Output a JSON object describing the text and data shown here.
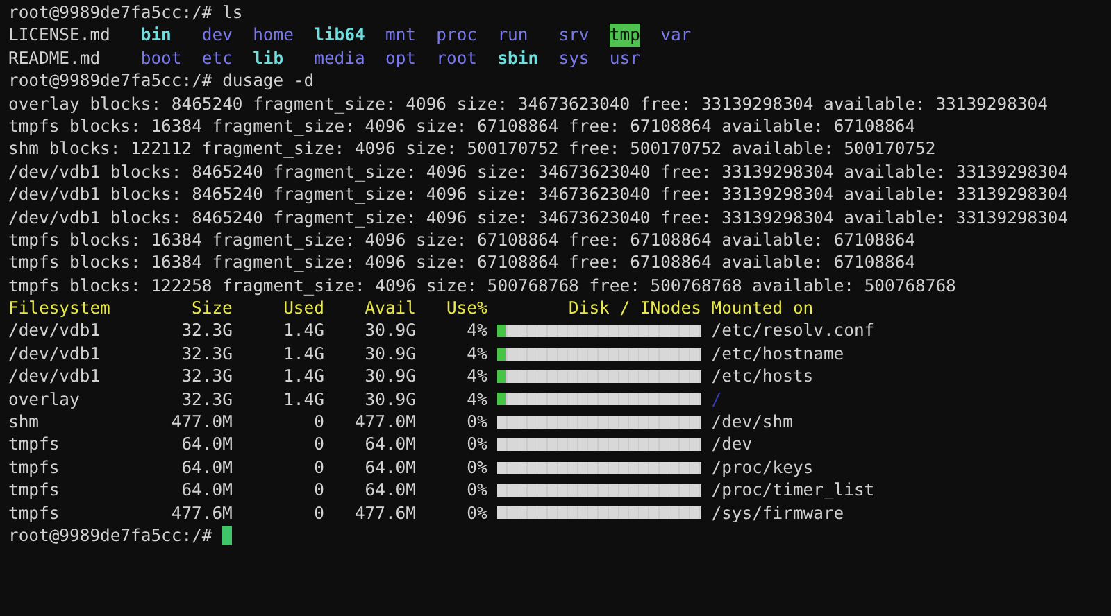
{
  "terminal": {
    "command_1": {
      "prompt": "root@9989de7fa5cc:/#",
      "command": "ls"
    },
    "ls_columns": [
      [
        {
          "name": "LICENSE.md",
          "kind": "file"
        },
        {
          "name": "README.md",
          "kind": "file"
        }
      ],
      [
        {
          "name": "bin",
          "kind": "link"
        },
        {
          "name": "boot",
          "kind": "dir"
        }
      ],
      [
        {
          "name": "dev",
          "kind": "dir"
        },
        {
          "name": "etc",
          "kind": "dir"
        }
      ],
      [
        {
          "name": "home",
          "kind": "dir"
        },
        {
          "name": "lib",
          "kind": "link"
        }
      ],
      [
        {
          "name": "lib64",
          "kind": "link"
        },
        {
          "name": "media",
          "kind": "dir"
        }
      ],
      [
        {
          "name": "mnt",
          "kind": "dir"
        },
        {
          "name": "opt",
          "kind": "dir"
        }
      ],
      [
        {
          "name": "proc",
          "kind": "dir"
        },
        {
          "name": "root",
          "kind": "dir"
        }
      ],
      [
        {
          "name": "run",
          "kind": "dir"
        },
        {
          "name": "sbin",
          "kind": "link"
        }
      ],
      [
        {
          "name": "srv",
          "kind": "dir"
        },
        {
          "name": "sys",
          "kind": "dir"
        }
      ],
      [
        {
          "name": "tmp",
          "kind": "sticky"
        },
        {
          "name": "usr",
          "kind": "dir"
        }
      ],
      [
        {
          "name": "var",
          "kind": "dir"
        }
      ]
    ],
    "command_2": {
      "prompt": "root@9989de7fa5cc:/#",
      "command": "dusage -d"
    },
    "output_lines": [
      "overlay blocks: 8465240 fragment_size: 4096 size: 34673623040 free: 33139298304 available: 33139298304",
      "tmpfs blocks: 16384 fragment_size: 4096 size: 67108864 free: 67108864 available: 67108864",
      "shm blocks: 122112 fragment_size: 4096 size: 500170752 free: 500170752 available: 500170752",
      "/dev/vdb1 blocks: 8465240 fragment_size: 4096 size: 34673623040 free: 33139298304 available: 33139298304",
      "/dev/vdb1 blocks: 8465240 fragment_size: 4096 size: 34673623040 free: 33139298304 available: 33139298304",
      "/dev/vdb1 blocks: 8465240 fragment_size: 4096 size: 34673623040 free: 33139298304 available: 33139298304",
      "tmpfs blocks: 16384 fragment_size: 4096 size: 67108864 free: 67108864 available: 67108864",
      "tmpfs blocks: 16384 fragment_size: 4096 size: 67108864 free: 67108864 available: 67108864",
      "tmpfs blocks: 122258 fragment_size: 4096 size: 500768768 free: 500768768 available: 500768768"
    ],
    "table": {
      "columns": [
        "Filesystem",
        "Size",
        "Used",
        "Avail",
        "Use%",
        "Disk / INodes",
        "Mounted on"
      ],
      "rows": [
        {
          "filesystem": "/dev/vdb1",
          "size": "32.3G",
          "used": "1.4G",
          "avail": "30.9G",
          "use": "4%",
          "level": 0.04,
          "mount": "/etc/resolv.conf",
          "color": "#d0d0d0"
        },
        {
          "filesystem": "/dev/vdb1",
          "size": "32.3G",
          "used": "1.4G",
          "avail": "30.9G",
          "use": "4%",
          "level": 0.04,
          "mount": "/etc/hostname",
          "color": "#d0d0d0"
        },
        {
          "filesystem": "/dev/vdb1",
          "size": "32.3G",
          "used": "1.4G",
          "avail": "30.9G",
          "use": "4%",
          "level": 0.04,
          "mount": "/etc/hosts",
          "color": "#d0d0d0"
        },
        {
          "filesystem": "overlay",
          "size": "32.3G",
          "used": "1.4G",
          "avail": "30.9G",
          "use": "4%",
          "level": 0.04,
          "mount": "/",
          "color": "#3a3ab8"
        },
        {
          "filesystem": "shm",
          "size": "477.0M",
          "used": "0",
          "avail": "477.0M",
          "use": "0%",
          "mount": "/dev/shm",
          "color": "#d0d0d0"
        },
        {
          "filesystem": "tmpfs",
          "size": "64.0M",
          "used": "0",
          "avail": "64.0M",
          "use": "0%",
          "mount": "/dev",
          "color": "#d0d0d0"
        },
        {
          "filesystem": "tmpfs",
          "size": "64.0M",
          "used": "0",
          "avail": "64.0M",
          "use": "0%",
          "mount": "/proc/keys",
          "color": "#d0d0d0"
        },
        {
          "filesystem": "tmpfs",
          "size": "64.0M",
          "used": "0",
          "avail": "64.0M",
          "use": "0%",
          "mount": "/proc/timer_list",
          "color": "#d0d0d0"
        },
        {
          "filesystem": "tmpfs",
          "size": "477.6M",
          "used": "0",
          "avail": "477.6M",
          "use": "0%",
          "mount": "/sys/firmware",
          "color": "#d0d0d0"
        }
      ]
    },
    "prompt": "root@9989de7fa5cc:/#"
  }
}
